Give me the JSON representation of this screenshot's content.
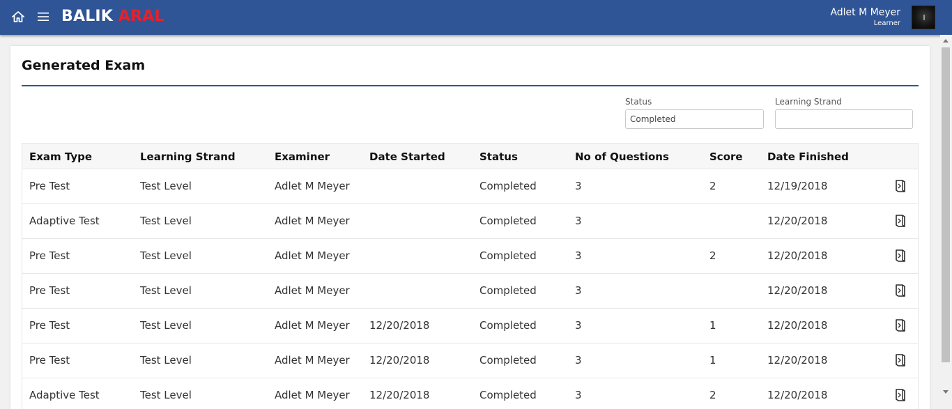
{
  "navbar": {
    "brand_part1": "BALIK",
    "brand_part2": "ARAL",
    "user_name": "Adlet M Meyer",
    "user_role": "Learner",
    "icons": {
      "home": "home-icon",
      "menu": "hamburger-menu-icon"
    },
    "brand_colors": {
      "bar": "#2f5596",
      "brand_accent": "#e8202a"
    }
  },
  "page": {
    "title": "Generated Exam"
  },
  "filters": {
    "status_label": "Status",
    "status_value": "Completed",
    "strand_label": "Learning Strand",
    "strand_value": ""
  },
  "table": {
    "headers": [
      "Exam Type",
      "Learning Strand",
      "Examiner",
      "Date Started",
      "Status",
      "No of Questions",
      "Score",
      "Date Finished"
    ],
    "rows": [
      {
        "exam_type": "Pre Test",
        "strand": "Test Level",
        "examiner": "Adlet M Meyer",
        "date_started": "",
        "status": "Completed",
        "questions": "3",
        "score": "2",
        "date_finished": "12/19/2018"
      },
      {
        "exam_type": "Adaptive Test",
        "strand": "Test Level",
        "examiner": "Adlet M Meyer",
        "date_started": "",
        "status": "Completed",
        "questions": "3",
        "score": "",
        "date_finished": "12/20/2018"
      },
      {
        "exam_type": "Pre Test",
        "strand": "Test Level",
        "examiner": "Adlet M Meyer",
        "date_started": "",
        "status": "Completed",
        "questions": "3",
        "score": "2",
        "date_finished": "12/20/2018"
      },
      {
        "exam_type": "Pre Test",
        "strand": "Test Level",
        "examiner": "Adlet M Meyer",
        "date_started": "",
        "status": "Completed",
        "questions": "3",
        "score": "",
        "date_finished": "12/20/2018"
      },
      {
        "exam_type": "Pre Test",
        "strand": "Test Level",
        "examiner": "Adlet M Meyer",
        "date_started": "12/20/2018",
        "status": "Completed",
        "questions": "3",
        "score": "1",
        "date_finished": "12/20/2018"
      },
      {
        "exam_type": "Pre Test",
        "strand": "Test Level",
        "examiner": "Adlet M Meyer",
        "date_started": "12/20/2018",
        "status": "Completed",
        "questions": "3",
        "score": "1",
        "date_finished": "12/20/2018"
      },
      {
        "exam_type": "Adaptive Test",
        "strand": "Test Level",
        "examiner": "Adlet M Meyer",
        "date_started": "12/20/2018",
        "status": "Completed",
        "questions": "3",
        "score": "2",
        "date_finished": "12/20/2018"
      }
    ],
    "row_action_icon": "open-book-icon"
  }
}
